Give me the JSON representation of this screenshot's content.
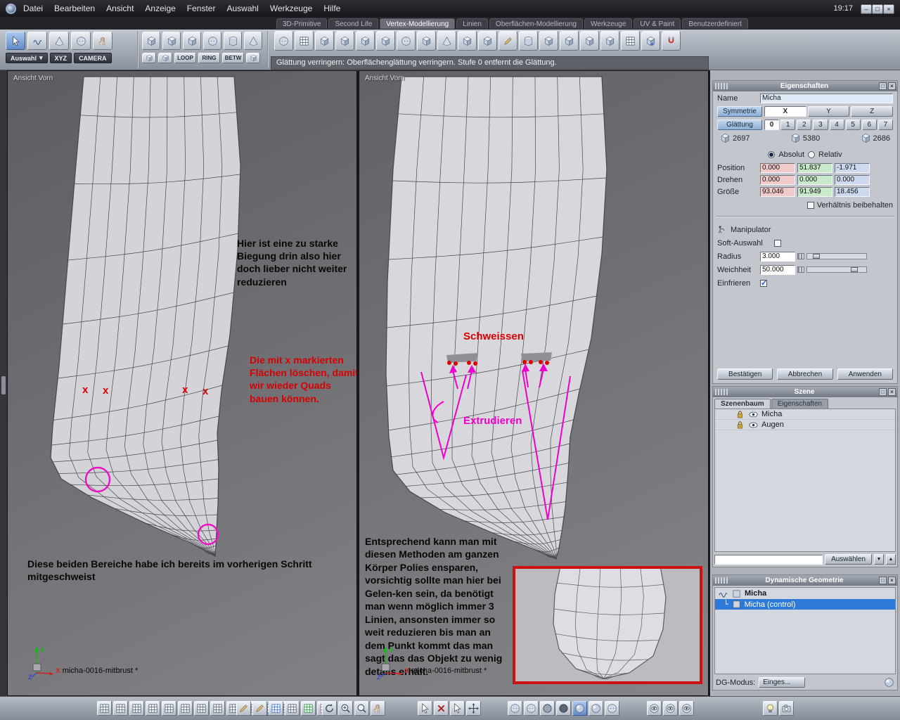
{
  "menubar": {
    "items": [
      "Datei",
      "Bearbeiten",
      "Ansicht",
      "Anzeige",
      "Fenster",
      "Auswahl",
      "Werkzeuge",
      "Hilfe"
    ],
    "clock": "19:17",
    "window_buttons": [
      "minimize",
      "maximize",
      "close"
    ]
  },
  "tabs": {
    "items": [
      "3D-Primitive",
      "Second Life",
      "Vertex-Modellierung",
      "Linien",
      "Oberflächen-Modellierung",
      "Werkzeuge",
      "UV & Paint",
      "Benutzerdefiniert"
    ],
    "active": "Vertex-Modellierung"
  },
  "toolbar": {
    "select_tools": [
      "select-arrow-icon",
      "curve-select-icon",
      "cone-select-icon",
      "sphere-select-icon",
      "hand-select-icon"
    ],
    "select_active_index": 0,
    "auswahl_label": "Auswahl",
    "xyz_label": "XYZ",
    "camera_label": "CAMERA",
    "component_tools": [
      "vertex-cube-icon",
      "edge-cube-icon",
      "face-cube-icon",
      "object-sphere-icon",
      "loop-cylinder-icon",
      "normal-cone-icon"
    ],
    "loop_label": "LOOP",
    "ring_label": "RING",
    "betw_label": "BETW",
    "component_extra": [
      "edge-select-icon",
      "border-select-icon",
      "between-select-icon"
    ],
    "modeling_tools": [
      "smooth-sphere-icon",
      "subdivide-grid-icon",
      "cube-extrude-icon",
      "inset-face-icon",
      "bevel-cube-icon",
      "bridge-icon",
      "weld-sphere-icon",
      "target-weld-icon",
      "collapse-cone-icon",
      "dissolve-icon",
      "split-cube-icon",
      "knife-pen-icon",
      "cut-loop-cylinder-icon",
      "mirror-icon",
      "symmetry-icon",
      "thicken-cube-icon",
      "smooth-decrease-icon",
      "tessellate-grid-icon",
      "add-plus-icon",
      "magnet-snap-icon"
    ],
    "status": "Glättung verringern: Oberflächenglättung verringern. Stufe 0 entfernt die Glättung."
  },
  "viewport_left": {
    "label": "Ansicht Vorn",
    "note_bend": "Hier ist eine zu starke Biegung drin also hier doch lieber nicht weiter reduzieren",
    "note_delete": "Die mit x markierten Flächen löschen, damit wir wieder Quads bauen können.",
    "x_glyph": "x",
    "note_welded": "Diese beiden Bereiche habe ich bereits im vorherigen Schritt mitgeschweist",
    "filename": "micha-0016-mitbrust *",
    "axis": {
      "x": "x",
      "y": "Y",
      "z": "Z"
    }
  },
  "viewport_right": {
    "label": "Ansicht Vorn",
    "note_weld": "Schweissen",
    "note_extrude": "Extrudieren",
    "note_body": "Entsprechend kann man mit diesen Methoden am ganzen Körper Polies ensparen, vorsichtig sollte man hier bei Gelen-ken sein, da benötigt man wenn möglich immer 3 Linien, ansonsten immer so weit reduzieren bis man an dem Punkt kommt das man sagt das das Objekt zu wenig details erhält.",
    "filename": "micha-0016-mitbrust *",
    "axis": {
      "x": "x",
      "y": "Y",
      "z": "Z"
    }
  },
  "properties": {
    "title": "Eigenschaften",
    "name_label": "Name",
    "name_value": "Micha",
    "symmetry_label": "Symmetrie",
    "axes": [
      "X",
      "Y",
      "Z"
    ],
    "axis_active": "X",
    "smoothing_label": "Glättung",
    "smoothing_levels": [
      "0",
      "1",
      "2",
      "3",
      "4",
      "5",
      "6",
      "7"
    ],
    "smoothing_active": "0",
    "counts": [
      {
        "icon": "vertex-count-icon",
        "value": "2697"
      },
      {
        "icon": "edge-count-icon",
        "value": "5380"
      },
      {
        "icon": "face-count-icon",
        "value": "2686"
      }
    ],
    "absolute_label": "Absolut",
    "relative_label": "Relativ",
    "mode_selected": "Absolut",
    "transform_rows": [
      {
        "label": "Position",
        "x": "0.000",
        "y": "51.837",
        "z": "-1.971"
      },
      {
        "label": "Drehen",
        "x": "0.000",
        "y": "0.000",
        "z": "0.000"
      },
      {
        "label": "Größe",
        "x": "93.046",
        "y": "91.949",
        "z": "18.456"
      }
    ],
    "keep_ratio_label": "Verhältnis beibehalten",
    "keep_ratio_checked": false,
    "manipulator_label": "Manipulator",
    "soft_select_label": "Soft-Auswahl",
    "soft_select_checked": false,
    "radius_label": "Radius",
    "radius_value": "3.000",
    "softness_label": "Weichheit",
    "softness_value": "50.000",
    "freeze_label": "Einfrieren",
    "freeze_checked": true,
    "confirm_label": "Bestätigen",
    "cancel_label": "Abbrechen",
    "apply_label": "Anwenden"
  },
  "scene": {
    "title": "Szene",
    "tabs": [
      "Szenenbaum",
      "Eigenschaften"
    ],
    "active_tab": "Szenenbaum",
    "items": [
      {
        "name": "Micha"
      },
      {
        "name": "Augen"
      }
    ],
    "filter_value": "",
    "select_button": "Auswählen"
  },
  "dynamic_geometry": {
    "title": "Dynamische Geometrie",
    "root": "Micha",
    "child": "Micha (control)",
    "child_selected": true,
    "mode_label": "DG-Modus:",
    "mode_value": "Einges..."
  },
  "bottom_bar": {
    "groups": [
      {
        "name": "view-layouts",
        "icons": [
          "single-view-icon",
          "four-view-icon",
          "two-view-h-icon",
          "two-view-v-icon",
          "three-view-icon",
          "grid-view-icon",
          "list-view-icon",
          "wide-view-icon",
          "tall-view-icon",
          "quad-view-icon",
          "active-view-icon",
          "full-view-icon"
        ],
        "active_index": 10
      },
      {
        "name": "draw-grids",
        "icons": [
          "ruler-pen-icon",
          "pen-icon",
          "grid-blue-icon",
          "grid-plain-icon",
          "grid-green-icon",
          "grid-multi-icon"
        ]
      },
      {
        "name": "navigation",
        "icons": [
          "orbit-icon",
          "zoom-in-icon",
          "zoom-icon",
          "hand-pan-icon"
        ]
      },
      {
        "name": "cursor-tools",
        "icons": [
          "cursor-icon",
          "delete-cross-icon",
          "cursor-pick-icon",
          "move-icon"
        ]
      },
      {
        "name": "shading-modes",
        "icons": [
          "wire-sphere-icon",
          "dotted-sphere-icon",
          "flat-circle-icon",
          "dark-circle-icon",
          "shaded-sphere-icon",
          "textured-sphere-icon",
          "points-sphere-icon"
        ],
        "active_index": 4
      },
      {
        "name": "visibility",
        "icons": [
          "eye-sphere-icon",
          "eye-sphere-icon",
          "eye-sphere-icon"
        ]
      },
      {
        "name": "render",
        "icons": [
          "light-icon",
          "camera-icon"
        ]
      }
    ]
  }
}
